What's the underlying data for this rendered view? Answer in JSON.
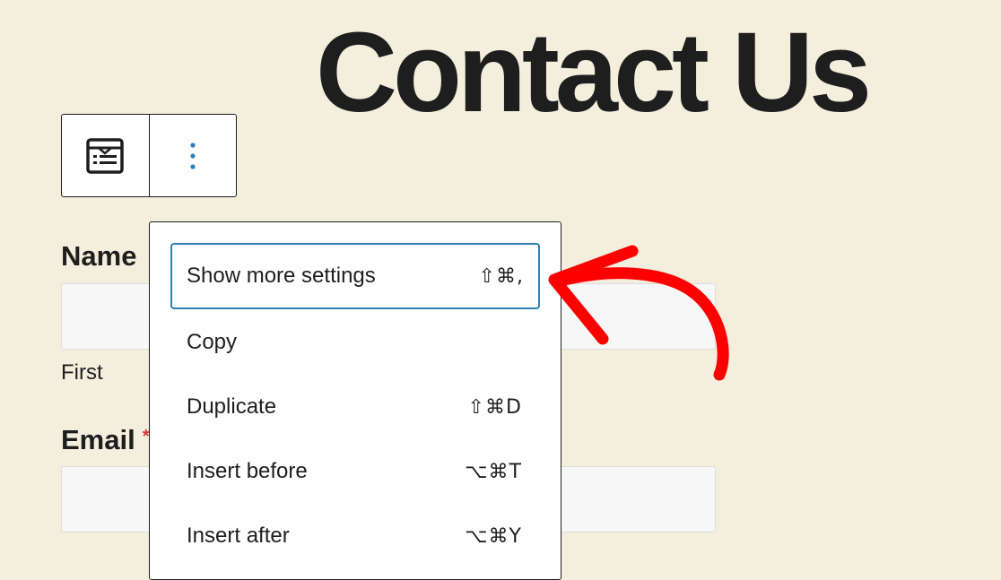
{
  "page": {
    "title": "Contact Us"
  },
  "toolbar": {
    "block_type_icon": "form-block-icon",
    "options_icon": "vertical-ellipsis-icon",
    "options_glyph": "⋮"
  },
  "form": {
    "fields": [
      {
        "label": "Name",
        "sublabel": "First",
        "required": false
      },
      {
        "label": "Email",
        "required": true,
        "required_mark": "*"
      }
    ]
  },
  "menu": {
    "items": [
      {
        "label": "Show more settings",
        "shortcut": "⇧⌘,",
        "focused": true
      },
      {
        "label": "Copy",
        "shortcut": ""
      },
      {
        "label": "Duplicate",
        "shortcut": "⇧⌘D"
      },
      {
        "label": "Insert before",
        "shortcut": "⌥⌘T"
      },
      {
        "label": "Insert after",
        "shortcut": "⌥⌘Y"
      }
    ]
  },
  "colors": {
    "background": "#f4eedd",
    "text": "#1e1e1e",
    "focus_border": "#2f7fb2",
    "options_icon": "#2f7fb2",
    "annotation_arrow": "#ff0000",
    "required": "#d63638"
  }
}
